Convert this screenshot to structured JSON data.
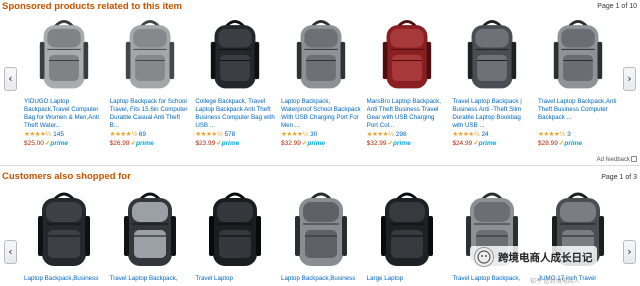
{
  "sponsored": {
    "title": "Sponsored products related to this item",
    "page_info": "Page 1 of 10",
    "ad_feedback": "Ad feedback",
    "products": [
      {
        "title": "YIDUGO Laptop Backpack,Travel Computer Bag for Women & Men,Anti Theft Water...",
        "stars": "★★★★½",
        "count": "145",
        "price": "$25.00",
        "prime": "prime",
        "colors": {
          "body": "#a9acae",
          "accent": "#7f8386",
          "dark": "#3a3c3e"
        }
      },
      {
        "title": "Laptop Backpack for School Travel, Fits 15.6in Computer Durable Casual Anti Theft B...",
        "stars": "★★★★½",
        "count": "69",
        "price": "$26.99",
        "prime": "prime",
        "colors": {
          "body": "#a4a7aa",
          "accent": "#86898c",
          "dark": "#45484b"
        }
      },
      {
        "title": "College Backpack, Travel Laptop Backpack Anti Theft Business Computer Bag with USB ...",
        "stars": "★★★★½",
        "count": "578",
        "price": "$23.99",
        "prime": "prime",
        "colors": {
          "body": "#23262a",
          "accent": "#3b3f44",
          "dark": "#0e0f11"
        }
      },
      {
        "title": "Laptop Backpack, Waterproof School Backpack With USB Charging Port For Men ...",
        "stars": "★★★★½",
        "count": "30",
        "price": "$32.99",
        "prime": "prime",
        "colors": {
          "body": "#8e9296",
          "accent": "#6d7175",
          "dark": "#2f3133"
        }
      },
      {
        "title": "MarsBro Laptop Backpack, Anti Theft Business Travel Gear with USB Charging Port Col...",
        "stars": "★★★★½",
        "count": "298",
        "price": "$32.99",
        "prime": "prime",
        "colors": {
          "body": "#8a1f22",
          "accent": "#a8393b",
          "dark": "#4e0e10"
        }
      },
      {
        "title": "Travel Laptop Backpack | Business Anti -Theft Slim Durable Laptop Bookbag with USB ...",
        "stars": "★★★★½",
        "count": "24",
        "price": "$24.99",
        "prime": "prime",
        "colors": {
          "body": "#4a4d52",
          "accent": "#6e7176",
          "dark": "#1f2124"
        }
      },
      {
        "title": "Travel Laptop Backpack,Anti Theft Business Computer Backpack ...",
        "stars": "★★★★½",
        "count": "3",
        "price": "$28.99",
        "prime": "prime",
        "colors": {
          "body": "#8f9397",
          "accent": "#6a6e72",
          "dark": "#2c2e30"
        }
      }
    ]
  },
  "customers": {
    "title": "Customers also shopped for",
    "page_info": "Page 1 of 3",
    "products": [
      {
        "title": "Laptop Backpack,Business",
        "colors": {
          "body": "#25282c",
          "accent": "#3d4146",
          "dark": "#0f1012"
        }
      },
      {
        "title": "Travel Laptop Backpack,",
        "colors": {
          "body": "#33363a",
          "accent": "#9aa0a6",
          "dark": "#111214"
        }
      },
      {
        "title": "Travel Laptop",
        "colors": {
          "body": "#1b1d20",
          "accent": "#34373b",
          "dark": "#08090a"
        }
      },
      {
        "title": "Laptop Backpack,Business",
        "colors": {
          "body": "#8a8e92",
          "accent": "#5e6266",
          "dark": "#2a2c2e"
        }
      },
      {
        "title": "Large Laptop",
        "colors": {
          "body": "#1e2023",
          "accent": "#36393d",
          "dark": "#0a0b0c"
        }
      },
      {
        "title": "Travel Laptop Backpack,",
        "colors": {
          "body": "#8d9195",
          "accent": "#6b6f73",
          "dark": "#2d2f31"
        }
      },
      {
        "title": "JUMO 17 inch Travel",
        "colors": {
          "body": "#4a4d52",
          "accent": "#7a7e83",
          "dark": "#1c1e20"
        }
      }
    ]
  },
  "nav": {
    "left": "‹",
    "right": "›"
  },
  "watermark": {
    "text": "跨境电商人成长日记",
    "faint": "知乎 @跨境电商人"
  }
}
